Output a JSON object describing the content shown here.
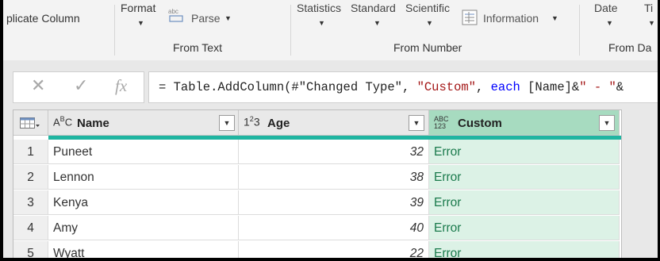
{
  "ribbon": {
    "duplicate_column": "plicate Column",
    "format": "Format",
    "parse": "Parse",
    "from_text": "From Text",
    "statistics": "Statistics",
    "standard": "Standard",
    "scientific": "Scientific",
    "information": "Information",
    "from_number": "From Number",
    "date": "Date",
    "time": "Ti",
    "from_date": "From Da"
  },
  "formula_bar": {
    "cancel_icon": "close-icon",
    "commit_icon": "check-icon",
    "fx": "fx",
    "p1": "= Table.AddColumn(#\"Changed Type\", ",
    "p2": "\"Custom\"",
    "p3": ", ",
    "p4": "each",
    "p5": " [Name]&",
    "p6": "\" - \"",
    "p7": "&"
  },
  "grid": {
    "columns": [
      {
        "type_icon": "ABC",
        "name": "Name"
      },
      {
        "type_icon": "123",
        "name": "Age"
      },
      {
        "type_icon": "ABC 123",
        "name": "Custom"
      }
    ],
    "rows": [
      {
        "n": "1",
        "name": "Puneet",
        "age": "32",
        "custom": "Error"
      },
      {
        "n": "2",
        "name": "Lennon",
        "age": "38",
        "custom": "Error"
      },
      {
        "n": "3",
        "name": "Kenya",
        "age": "39",
        "custom": "Error"
      },
      {
        "n": "4",
        "name": "Amy",
        "age": "40",
        "custom": "Error"
      },
      {
        "n": "5",
        "name": "Wyatt",
        "age": "22",
        "custom": "Error"
      }
    ]
  },
  "colors": {
    "accent_teal": "#1fb5a1",
    "selected_header": "#a7dbc0",
    "error_cell": "#dcf2e6",
    "error_text": "#1a7a4c"
  }
}
